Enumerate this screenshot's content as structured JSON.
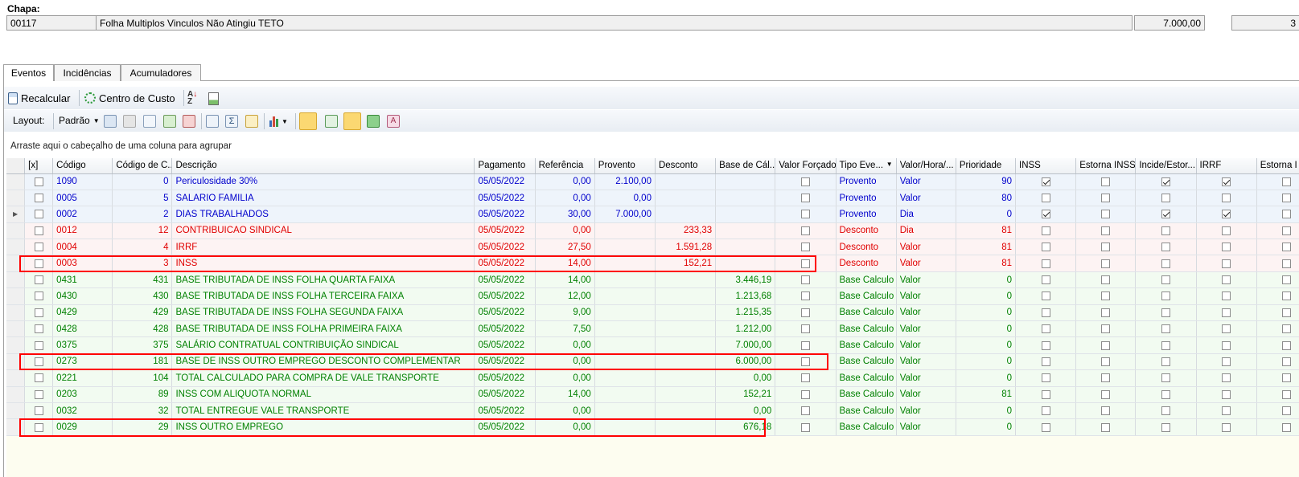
{
  "header": {
    "chapa_label": "Chapa:",
    "chapa_code": "00117",
    "description": "Folha Multiplos Vinculos Não Atingiu TETO",
    "amount": "7.000,00",
    "extra": "3"
  },
  "tabs": [
    {
      "label": "Eventos",
      "active": true
    },
    {
      "label": "Incidências",
      "active": false
    },
    {
      "label": "Acumuladores",
      "active": false
    }
  ],
  "toolbar1": {
    "recalcular": "Recalcular",
    "centro_custo": "Centro de Custo"
  },
  "toolbar2": {
    "layout_label": "Layout:",
    "padrao": "Padrão"
  },
  "group_hint": "Arraste aqui o cabeçalho de uma coluna para agrupar",
  "columns": [
    "[x]",
    "Código",
    "Código de C...",
    "Descrição",
    "Pagamento",
    "Referência",
    "Provento",
    "Desconto",
    "Base de Cál...",
    "Valor Forçado",
    "Tipo Eve...",
    "Valor/Hora/...",
    "Prioridade",
    "INSS",
    "Estorna INSS",
    "Incide/Estor...",
    "IRRF",
    "Estorna I"
  ],
  "rows": [
    {
      "type": "blue",
      "current": false,
      "codigo": "1090",
      "codc": "0",
      "descricao": "Periculosidade 30%",
      "pagamento": "05/05/2022",
      "referencia": "0,00",
      "provento": "2.100,00",
      "desconto": "",
      "base": "",
      "tipo": "Provento",
      "vh": "Valor",
      "prioridade": "90",
      "inss": true,
      "estorna_inss": false,
      "incide": true,
      "irrf": true,
      "estorna_irrf": false
    },
    {
      "type": "blue",
      "current": false,
      "codigo": "0005",
      "codc": "5",
      "descricao": "SALARIO FAMILIA",
      "pagamento": "05/05/2022",
      "referencia": "0,00",
      "provento": "0,00",
      "desconto": "",
      "base": "",
      "tipo": "Provento",
      "vh": "Valor",
      "prioridade": "80",
      "inss": false,
      "estorna_inss": false,
      "incide": false,
      "irrf": false,
      "estorna_irrf": false
    },
    {
      "type": "blue",
      "current": true,
      "codigo": "0002",
      "codc": "2",
      "descricao": "DIAS TRABALHADOS",
      "pagamento": "05/05/2022",
      "referencia": "30,00",
      "provento": "7.000,00",
      "desconto": "",
      "base": "",
      "tipo": "Provento",
      "vh": "Dia",
      "prioridade": "0",
      "inss": true,
      "estorna_inss": false,
      "incide": true,
      "irrf": true,
      "estorna_irrf": false
    },
    {
      "type": "red",
      "current": false,
      "codigo": "0012",
      "codc": "12",
      "descricao": "CONTRIBUICAO SINDICAL",
      "pagamento": "05/05/2022",
      "referencia": "0,00",
      "provento": "",
      "desconto": "233,33",
      "base": "",
      "tipo": "Desconto",
      "vh": "Dia",
      "prioridade": "81",
      "inss": false,
      "estorna_inss": false,
      "incide": false,
      "irrf": false,
      "estorna_irrf": false
    },
    {
      "type": "red",
      "current": false,
      "codigo": "0004",
      "codc": "4",
      "descricao": "IRRF",
      "pagamento": "05/05/2022",
      "referencia": "27,50",
      "provento": "",
      "desconto": "1.591,28",
      "base": "",
      "tipo": "Desconto",
      "vh": "Valor",
      "prioridade": "81",
      "inss": false,
      "estorna_inss": false,
      "incide": false,
      "irrf": false,
      "estorna_irrf": false
    },
    {
      "type": "red",
      "current": false,
      "codigo": "0003",
      "codc": "3",
      "descricao": "INSS",
      "pagamento": "05/05/2022",
      "referencia": "14,00",
      "provento": "",
      "desconto": "152,21",
      "base": "",
      "tipo": "Desconto",
      "vh": "Valor",
      "prioridade": "81",
      "inss": false,
      "estorna_inss": false,
      "incide": false,
      "irrf": false,
      "estorna_irrf": false
    },
    {
      "type": "green",
      "current": false,
      "codigo": "0431",
      "codc": "431",
      "descricao": "BASE TRIBUTADA DE INSS FOLHA QUARTA FAIXA",
      "pagamento": "05/05/2022",
      "referencia": "14,00",
      "provento": "",
      "desconto": "",
      "base": "3.446,19",
      "tipo": "Base Calculo",
      "vh": "Valor",
      "prioridade": "0",
      "inss": false,
      "estorna_inss": false,
      "incide": false,
      "irrf": false,
      "estorna_irrf": false
    },
    {
      "type": "green",
      "current": false,
      "codigo": "0430",
      "codc": "430",
      "descricao": "BASE TRIBUTADA DE INSS FOLHA TERCEIRA FAIXA",
      "pagamento": "05/05/2022",
      "referencia": "12,00",
      "provento": "",
      "desconto": "",
      "base": "1.213,68",
      "tipo": "Base Calculo",
      "vh": "Valor",
      "prioridade": "0",
      "inss": false,
      "estorna_inss": false,
      "incide": false,
      "irrf": false,
      "estorna_irrf": false
    },
    {
      "type": "green",
      "current": false,
      "codigo": "0429",
      "codc": "429",
      "descricao": "BASE TRIBUTADA DE INSS FOLHA SEGUNDA FAIXA",
      "pagamento": "05/05/2022",
      "referencia": "9,00",
      "provento": "",
      "desconto": "",
      "base": "1.215,35",
      "tipo": "Base Calculo",
      "vh": "Valor",
      "prioridade": "0",
      "inss": false,
      "estorna_inss": false,
      "incide": false,
      "irrf": false,
      "estorna_irrf": false
    },
    {
      "type": "green",
      "current": false,
      "codigo": "0428",
      "codc": "428",
      "descricao": "BASE TRIBUTADA DE INSS FOLHA PRIMEIRA FAIXA",
      "pagamento": "05/05/2022",
      "referencia": "7,50",
      "provento": "",
      "desconto": "",
      "base": "1.212,00",
      "tipo": "Base Calculo",
      "vh": "Valor",
      "prioridade": "0",
      "inss": false,
      "estorna_inss": false,
      "incide": false,
      "irrf": false,
      "estorna_irrf": false
    },
    {
      "type": "green",
      "current": false,
      "codigo": "0375",
      "codc": "375",
      "descricao": "SALÁRIO CONTRATUAL CONTRIBUIÇÃO SINDICAL",
      "pagamento": "05/05/2022",
      "referencia": "0,00",
      "provento": "",
      "desconto": "",
      "base": "7.000,00",
      "tipo": "Base Calculo",
      "vh": "Valor",
      "prioridade": "0",
      "inss": false,
      "estorna_inss": false,
      "incide": false,
      "irrf": false,
      "estorna_irrf": false
    },
    {
      "type": "green",
      "current": false,
      "codigo": "0273",
      "codc": "181",
      "descricao": "BASE DE INSS OUTRO EMPREGO DESCONTO COMPLEMENTAR",
      "pagamento": "05/05/2022",
      "referencia": "0,00",
      "provento": "",
      "desconto": "",
      "base": "6.000,00",
      "tipo": "Base Calculo",
      "vh": "Valor",
      "prioridade": "0",
      "inss": false,
      "estorna_inss": false,
      "incide": false,
      "irrf": false,
      "estorna_irrf": false
    },
    {
      "type": "green",
      "current": false,
      "codigo": "0221",
      "codc": "104",
      "descricao": "TOTAL CALCULADO PARA COMPRA DE VALE TRANSPORTE",
      "pagamento": "05/05/2022",
      "referencia": "0,00",
      "provento": "",
      "desconto": "",
      "base": "0,00",
      "tipo": "Base Calculo",
      "vh": "Valor",
      "prioridade": "0",
      "inss": false,
      "estorna_inss": false,
      "incide": false,
      "irrf": false,
      "estorna_irrf": false
    },
    {
      "type": "green",
      "current": false,
      "codigo": "0203",
      "codc": "89",
      "descricao": "INSS COM ALIQUOTA NORMAL",
      "pagamento": "05/05/2022",
      "referencia": "14,00",
      "provento": "",
      "desconto": "",
      "base": "152,21",
      "tipo": "Base Calculo",
      "vh": "Valor",
      "prioridade": "81",
      "inss": false,
      "estorna_inss": false,
      "incide": false,
      "irrf": false,
      "estorna_irrf": false
    },
    {
      "type": "green",
      "current": false,
      "codigo": "0032",
      "codc": "32",
      "descricao": "TOTAL ENTREGUE VALE TRANSPORTE",
      "pagamento": "05/05/2022",
      "referencia": "0,00",
      "provento": "",
      "desconto": "",
      "base": "0,00",
      "tipo": "Base Calculo",
      "vh": "Valor",
      "prioridade": "0",
      "inss": false,
      "estorna_inss": false,
      "incide": false,
      "irrf": false,
      "estorna_irrf": false
    },
    {
      "type": "green",
      "current": false,
      "codigo": "0029",
      "codc": "29",
      "descricao": "INSS OUTRO EMPREGO",
      "pagamento": "05/05/2022",
      "referencia": "0,00",
      "provento": "",
      "desconto": "",
      "base": "676,18",
      "tipo": "Base Calculo",
      "vh": "Valor",
      "prioridade": "0",
      "inss": false,
      "estorna_inss": false,
      "incide": false,
      "irrf": false,
      "estorna_irrf": false
    }
  ],
  "colors": {
    "provento": "#0000cc",
    "desconto": "#e00000",
    "base_calculo": "#008000",
    "highlight": "#ff0000"
  }
}
